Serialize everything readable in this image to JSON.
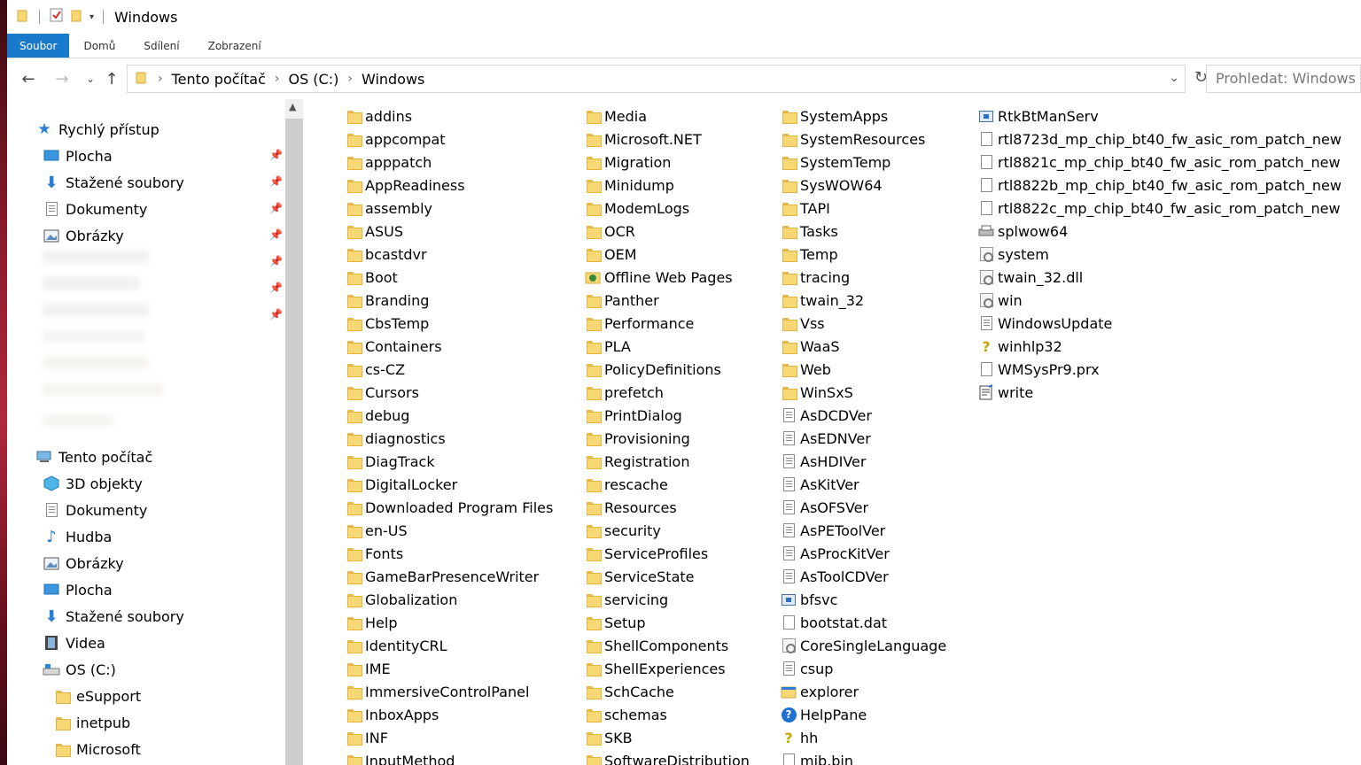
{
  "window": {
    "title": "Windows"
  },
  "ribbon": {
    "tabs": [
      "Soubor",
      "Domů",
      "Sdílení",
      "Zobrazení"
    ],
    "active_tab": "Soubor"
  },
  "address": {
    "crumbs": [
      "Tento počítač",
      "OS (C:)",
      "Windows"
    ],
    "search_placeholder": "Prohledat: Windows"
  },
  "nav": {
    "quick_access": "Rychlý přístup",
    "pinned": [
      {
        "label": "Plocha",
        "icon": "desktop-icon"
      },
      {
        "label": "Stažené soubory",
        "icon": "download-icon"
      },
      {
        "label": "Dokumenty",
        "icon": "documents-icon"
      },
      {
        "label": "Obrázky",
        "icon": "pictures-icon"
      }
    ],
    "this_pc": "Tento počítač",
    "pc_items": [
      {
        "label": "3D objekty",
        "icon": "3d-objects-icon"
      },
      {
        "label": "Dokumenty",
        "icon": "documents-icon"
      },
      {
        "label": "Hudba",
        "icon": "music-icon"
      },
      {
        "label": "Obrázky",
        "icon": "pictures-icon"
      },
      {
        "label": "Plocha",
        "icon": "desktop-icon"
      },
      {
        "label": "Stažené soubory",
        "icon": "download-icon"
      },
      {
        "label": "Videa",
        "icon": "video-icon"
      },
      {
        "label": "OS (C:)",
        "icon": "drive-icon"
      }
    ],
    "drive_children": [
      "eSupport",
      "inetpub",
      "Microsoft"
    ]
  },
  "files": {
    "col1": [
      {
        "name": "addins",
        "type": "folder"
      },
      {
        "name": "appcompat",
        "type": "folder"
      },
      {
        "name": "apppatch",
        "type": "folder"
      },
      {
        "name": "AppReadiness",
        "type": "folder"
      },
      {
        "name": "assembly",
        "type": "folder"
      },
      {
        "name": "ASUS",
        "type": "folder"
      },
      {
        "name": "bcastdvr",
        "type": "folder"
      },
      {
        "name": "Boot",
        "type": "folder"
      },
      {
        "name": "Branding",
        "type": "folder"
      },
      {
        "name": "CbsTemp",
        "type": "folder"
      },
      {
        "name": "Containers",
        "type": "folder"
      },
      {
        "name": "cs-CZ",
        "type": "folder"
      },
      {
        "name": "Cursors",
        "type": "folder"
      },
      {
        "name": "debug",
        "type": "folder"
      },
      {
        "name": "diagnostics",
        "type": "folder"
      },
      {
        "name": "DiagTrack",
        "type": "folder"
      },
      {
        "name": "DigitalLocker",
        "type": "folder"
      },
      {
        "name": "Downloaded Program Files",
        "type": "folder"
      },
      {
        "name": "en-US",
        "type": "folder"
      },
      {
        "name": "Fonts",
        "type": "fonts"
      },
      {
        "name": "GameBarPresenceWriter",
        "type": "folder"
      },
      {
        "name": "Globalization",
        "type": "folder"
      },
      {
        "name": "Help",
        "type": "folder"
      },
      {
        "name": "IdentityCRL",
        "type": "folder"
      },
      {
        "name": "IME",
        "type": "folder"
      },
      {
        "name": "ImmersiveControlPanel",
        "type": "folder"
      },
      {
        "name": "InboxApps",
        "type": "folder"
      },
      {
        "name": "INF",
        "type": "folder"
      },
      {
        "name": "InputMethod",
        "type": "folder"
      }
    ],
    "col2": [
      {
        "name": "Media",
        "type": "folder"
      },
      {
        "name": "Microsoft.NET",
        "type": "folder"
      },
      {
        "name": "Migration",
        "type": "folder"
      },
      {
        "name": "Minidump",
        "type": "folder"
      },
      {
        "name": "ModemLogs",
        "type": "folder"
      },
      {
        "name": "OCR",
        "type": "folder"
      },
      {
        "name": "OEM",
        "type": "folder"
      },
      {
        "name": "Offline Web Pages",
        "type": "special"
      },
      {
        "name": "Panther",
        "type": "folder"
      },
      {
        "name": "Performance",
        "type": "folder"
      },
      {
        "name": "PLA",
        "type": "folder"
      },
      {
        "name": "PolicyDefinitions",
        "type": "folder"
      },
      {
        "name": "prefetch",
        "type": "folder"
      },
      {
        "name": "PrintDialog",
        "type": "folder"
      },
      {
        "name": "Provisioning",
        "type": "folder"
      },
      {
        "name": "Registration",
        "type": "folder"
      },
      {
        "name": "rescache",
        "type": "folder"
      },
      {
        "name": "Resources",
        "type": "folder"
      },
      {
        "name": "security",
        "type": "folder"
      },
      {
        "name": "ServiceProfiles",
        "type": "folder"
      },
      {
        "name": "ServiceState",
        "type": "folder"
      },
      {
        "name": "servicing",
        "type": "folder"
      },
      {
        "name": "Setup",
        "type": "folder"
      },
      {
        "name": "ShellComponents",
        "type": "folder"
      },
      {
        "name": "ShellExperiences",
        "type": "folder"
      },
      {
        "name": "SchCache",
        "type": "folder"
      },
      {
        "name": "schemas",
        "type": "folder"
      },
      {
        "name": "SKB",
        "type": "folder"
      },
      {
        "name": "SoftwareDistribution",
        "type": "folder"
      }
    ],
    "col3": [
      {
        "name": "SystemApps",
        "type": "folder"
      },
      {
        "name": "SystemResources",
        "type": "folder"
      },
      {
        "name": "SystemTemp",
        "type": "folder"
      },
      {
        "name": "SysWOW64",
        "type": "folder"
      },
      {
        "name": "TAPI",
        "type": "folder"
      },
      {
        "name": "Tasks",
        "type": "folder"
      },
      {
        "name": "Temp",
        "type": "folder"
      },
      {
        "name": "tracing",
        "type": "folder"
      },
      {
        "name": "twain_32",
        "type": "folder"
      },
      {
        "name": "Vss",
        "type": "folder"
      },
      {
        "name": "WaaS",
        "type": "folder"
      },
      {
        "name": "Web",
        "type": "folder"
      },
      {
        "name": "WinSxS",
        "type": "folder"
      },
      {
        "name": "AsDCDVer",
        "type": "text"
      },
      {
        "name": "AsEDNVer",
        "type": "text"
      },
      {
        "name": "AsHDIVer",
        "type": "text"
      },
      {
        "name": "AsKitVer",
        "type": "text"
      },
      {
        "name": "AsOFSVer",
        "type": "text"
      },
      {
        "name": "AsPEToolVer",
        "type": "text"
      },
      {
        "name": "AsProcKitVer",
        "type": "text"
      },
      {
        "name": "AsToolCDVer",
        "type": "text"
      },
      {
        "name": "bfsvc",
        "type": "app"
      },
      {
        "name": "bootstat.dat",
        "type": "file"
      },
      {
        "name": "CoreSingleLanguage",
        "type": "cert"
      },
      {
        "name": "csup",
        "type": "text"
      },
      {
        "name": "explorer",
        "type": "explorer"
      },
      {
        "name": "HelpPane",
        "type": "help"
      },
      {
        "name": "hh",
        "type": "hh"
      },
      {
        "name": "mib.bin",
        "type": "file"
      }
    ],
    "col4": [
      {
        "name": "RtkBtManServ",
        "type": "app"
      },
      {
        "name": "rtl8723d_mp_chip_bt40_fw_asic_rom_patch_new",
        "type": "file"
      },
      {
        "name": "rtl8821c_mp_chip_bt40_fw_asic_rom_patch_new",
        "type": "file"
      },
      {
        "name": "rtl8822b_mp_chip_bt40_fw_asic_rom_patch_new",
        "type": "file"
      },
      {
        "name": "rtl8822c_mp_chip_bt40_fw_asic_rom_patch_new",
        "type": "file"
      },
      {
        "name": "splwow64",
        "type": "printer"
      },
      {
        "name": "system",
        "type": "gear"
      },
      {
        "name": "twain_32.dll",
        "type": "gear"
      },
      {
        "name": "win",
        "type": "gear"
      },
      {
        "name": "WindowsUpdate",
        "type": "text"
      },
      {
        "name": "winhlp32",
        "type": "winhlp"
      },
      {
        "name": "WMSysPr9.prx",
        "type": "file"
      },
      {
        "name": "write",
        "type": "write"
      }
    ]
  }
}
